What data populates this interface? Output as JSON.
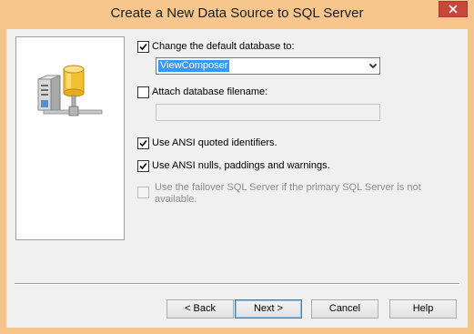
{
  "window": {
    "title": "Create a New Data Source to SQL Server"
  },
  "options": {
    "change_default_db": {
      "label": "Change the default database to:",
      "checked": true
    },
    "default_db_value": "ViewComposer",
    "attach_db": {
      "label": "Attach database filename:",
      "checked": false
    },
    "attach_db_value": "",
    "ansi_quoted": {
      "label": "Use ANSI quoted identifiers.",
      "checked": true
    },
    "ansi_nulls": {
      "label": "Use ANSI nulls, paddings and warnings.",
      "checked": true
    },
    "failover": {
      "label": "Use the failover SQL Server if the primary SQL Server is not available.",
      "checked": false,
      "enabled": false
    }
  },
  "buttons": {
    "back": "< Back",
    "next": "Next >",
    "cancel": "Cancel",
    "help": "Help"
  },
  "colors": {
    "titlebar": "#f6c68c",
    "close": "#c9463d",
    "selection": "#3399ff"
  },
  "icons": {
    "close": "close-icon",
    "server": "database-server-icon",
    "dropdown": "chevron-down-icon"
  }
}
